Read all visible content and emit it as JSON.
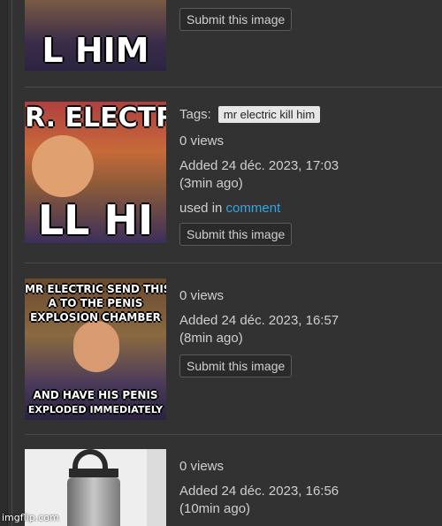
{
  "items": [
    {
      "submit_label": "Submit this image",
      "thumb_text_bottom": "L HIM"
    },
    {
      "tags_label": "Tags:",
      "tag": "mr electric kill him",
      "views": "0 views",
      "added": "Added 24 déc. 2023, 17:03",
      "ago": "(3min ago)",
      "used_in": "used in",
      "used_in_link": "comment",
      "submit_label": "Submit this image",
      "thumb_text_top": "R. ELECTR",
      "thumb_text_bottom": "LL HI"
    },
    {
      "views": "0 views",
      "added": "Added 24 déc. 2023, 16:57",
      "ago": "(8min ago)",
      "submit_label": "Submit this image",
      "thumb_text_top_1": "MR ELECTRIC SEND THIS",
      "thumb_text_top_2": "A TO THE PENIS",
      "thumb_text_top_3": "EXPLOSION CHAMBER",
      "thumb_text_bottom_1": "AND HAVE HIS PENIS",
      "thumb_text_bottom_2": "EXPLODED IMMEDIATELY"
    },
    {
      "views": "0 views",
      "added": "Added 24 déc. 2023, 16:56",
      "ago": "(10min ago)"
    }
  ],
  "watermark": "imgflip.com"
}
